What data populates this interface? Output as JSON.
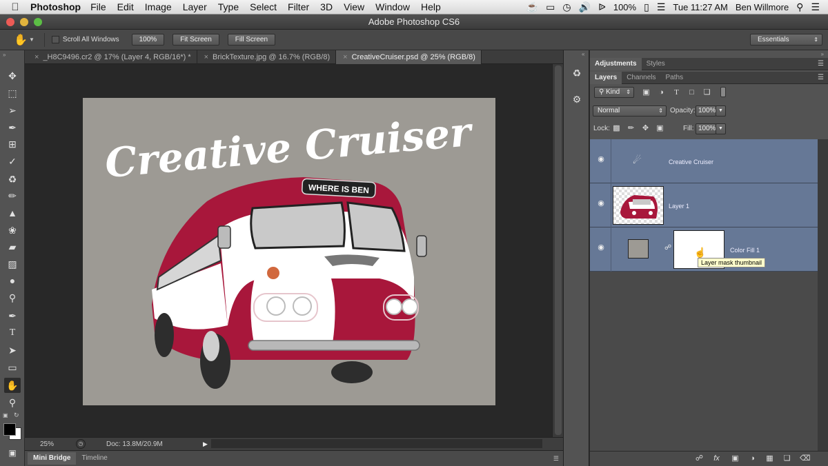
{
  "menubar": {
    "app_name": "Photoshop",
    "items": [
      "File",
      "Edit",
      "Image",
      "Layer",
      "Type",
      "Select",
      "Filter",
      "3D",
      "View",
      "Window",
      "Help"
    ],
    "battery": "100%",
    "clock": "Tue 11:27 AM",
    "user": "Ben Willmore"
  },
  "window": {
    "title": "Adobe Photoshop CS6"
  },
  "options_bar": {
    "scroll_all_windows": "Scroll All Windows",
    "zoom_100": "100%",
    "fit_screen": "Fit Screen",
    "fill_screen": "Fill Screen",
    "workspace": "Essentials"
  },
  "doc_tabs": [
    {
      "label": "_H8C9496.cr2 @ 17% (Layer 4, RGB/16*) *",
      "active": false
    },
    {
      "label": "BrickTexture.jpg @ 16.7% (RGB/8)",
      "active": false
    },
    {
      "label": "CreativeCruiser.psd @ 25% (RGB/8)",
      "active": true
    }
  ],
  "artwork": {
    "headline": "Creative Cruiser",
    "bus_sign": "WHERE IS BEN"
  },
  "status_bar": {
    "zoom": "25%",
    "doc_size": "Doc: 13.8M/20.9M"
  },
  "bottom_tabs": [
    "Mini Bridge",
    "Timeline"
  ],
  "panels": {
    "top_tabs": [
      "Adjustments",
      "Styles"
    ],
    "layer_tabs": [
      "Layers",
      "Channels",
      "Paths"
    ],
    "filter_kind": "Kind",
    "blend_mode": "Normal",
    "opacity_label": "Opacity:",
    "opacity_value": "100%",
    "lock_label": "Lock:",
    "fill_label": "Fill:",
    "fill_value": "100%"
  },
  "layers": [
    {
      "name": "Creative Cruiser"
    },
    {
      "name": "Layer 1"
    },
    {
      "name": "Color Fill 1"
    }
  ],
  "tooltip": "Layer mask thumbnail",
  "colors": {
    "bus_red": "#a8173b",
    "layer_selected": "#667896",
    "canvas_bg": "#9d9a94"
  }
}
